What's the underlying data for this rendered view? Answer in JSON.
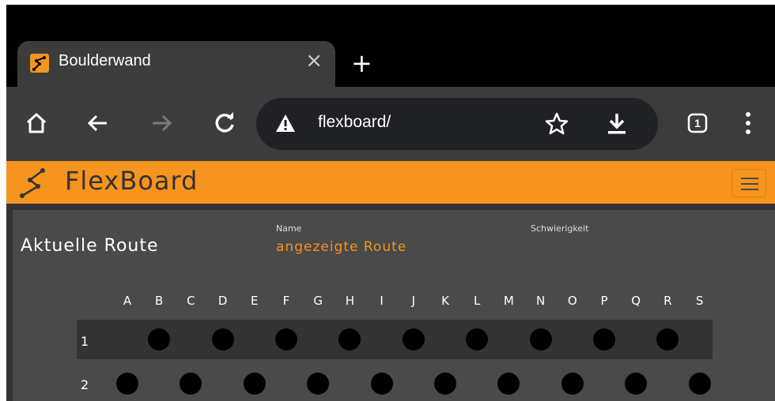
{
  "browser": {
    "tab_title": "Boulderwand",
    "close_glyph": "×",
    "new_tab_glyph": "+",
    "url": "flexboard/",
    "tab_count": "1",
    "security": "warning-icon"
  },
  "app": {
    "brand": "FlexBoard",
    "accent": "#f7941d"
  },
  "route": {
    "heading": "Aktuelle Route",
    "name_label": "Name",
    "name_value": "angezeigte Route",
    "difficulty_label": "Schwierigkeit",
    "difficulty_value": ""
  },
  "board": {
    "columns": [
      "A",
      "B",
      "C",
      "D",
      "E",
      "F",
      "G",
      "H",
      "I",
      "J",
      "K",
      "L",
      "M",
      "N",
      "O",
      "P",
      "Q",
      "R",
      "S"
    ],
    "rows": [
      {
        "label": "1"
      },
      {
        "label": "2"
      }
    ]
  }
}
